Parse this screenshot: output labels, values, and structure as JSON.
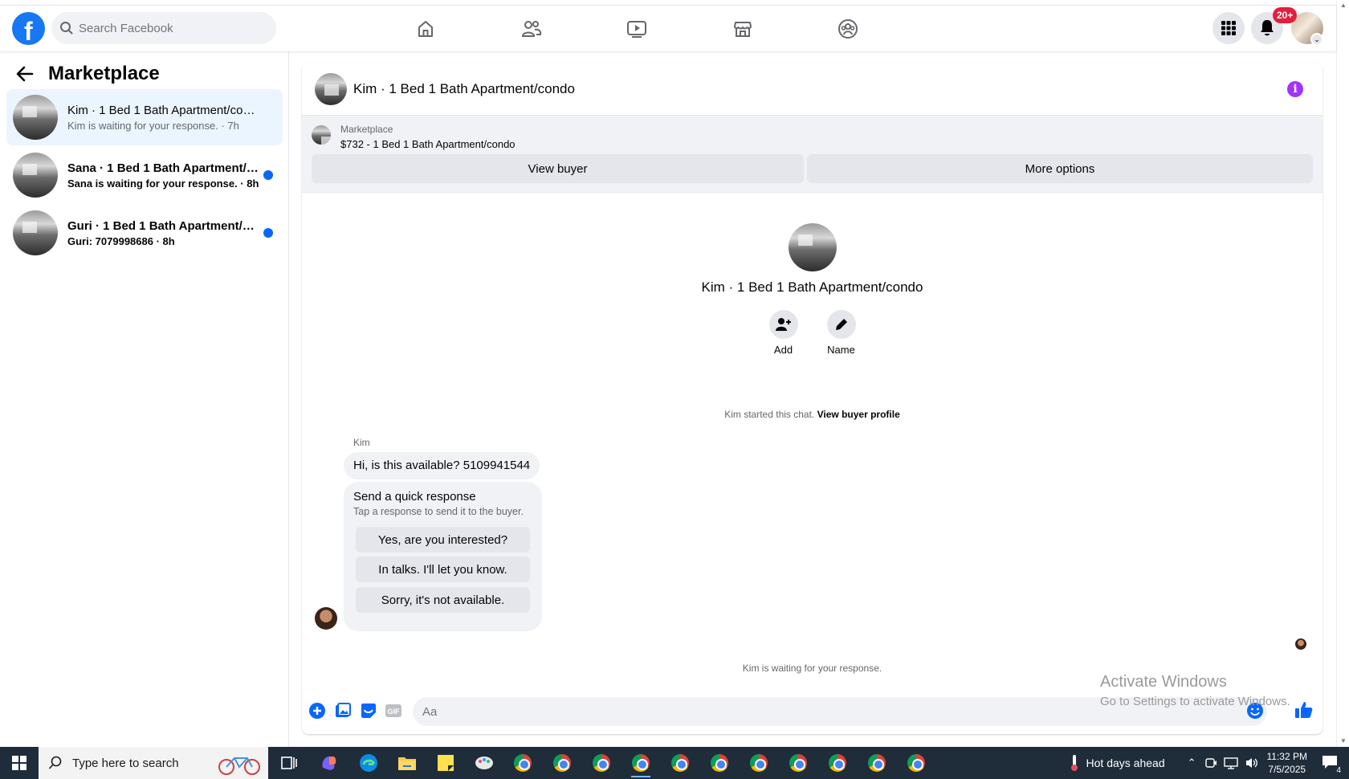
{
  "app": {
    "name": "Facebook",
    "accent": "#1877f2",
    "unread_dot_color": "#0866ff",
    "info_color": "#a033ff"
  },
  "topnav": {
    "search_placeholder": "Search Facebook",
    "nav_icons": [
      "home-icon",
      "friends-icon",
      "watch-icon",
      "marketplace-icon",
      "groups-icon"
    ],
    "notifications_badge": "20+"
  },
  "sidebar": {
    "title": "Marketplace",
    "conversations": [
      {
        "name": "Kim · 1 Bed 1 Bath Apartment/condo",
        "subtitle": "Kim is waiting for your response. · 7h",
        "active": true,
        "unread": false
      },
      {
        "name": "Sana · 1 Bed 1 Bath Apartment/c...",
        "subtitle": "Sana is waiting for your response. · 8h",
        "active": false,
        "unread": true
      },
      {
        "name": "Guri · 1 Bed 1 Bath Apartment/co...",
        "subtitle": "Guri: 7079998686 · 8h",
        "active": false,
        "unread": true
      }
    ]
  },
  "chat": {
    "header_title": "Kim · 1 Bed 1 Bath Apartment/condo",
    "listing": {
      "label": "Marketplace",
      "price_title": "$732 - 1 Bed 1 Bath Apartment/condo",
      "view_buyer": "View buyer",
      "more_options": "More options"
    },
    "profile": {
      "name": "Kim · 1 Bed 1 Bath Apartment/condo",
      "add_label": "Add",
      "name_label": "Name"
    },
    "started_text": "Kim started this chat.",
    "view_buyer_profile": "View buyer profile",
    "sender": "Kim",
    "message": "Hi, is this available? 5109941544",
    "quick_response": {
      "title": "Send a quick response",
      "subtitle": "Tap a response to send it to the buyer.",
      "options": [
        "Yes, are you interested?",
        "In talks. I'll let you know.",
        "Sorry, it's not available."
      ]
    },
    "waiting_text": "Kim is waiting for your response.",
    "composer_placeholder": "Aa"
  },
  "watermark": {
    "line1": "Activate Windows",
    "line2": "Go to Settings to activate Windows."
  },
  "taskbar": {
    "search_placeholder": "Type here to search",
    "weather": "Hot days ahead",
    "time": "11:32 PM",
    "date": "7/5/2025",
    "notification_count": "4"
  }
}
